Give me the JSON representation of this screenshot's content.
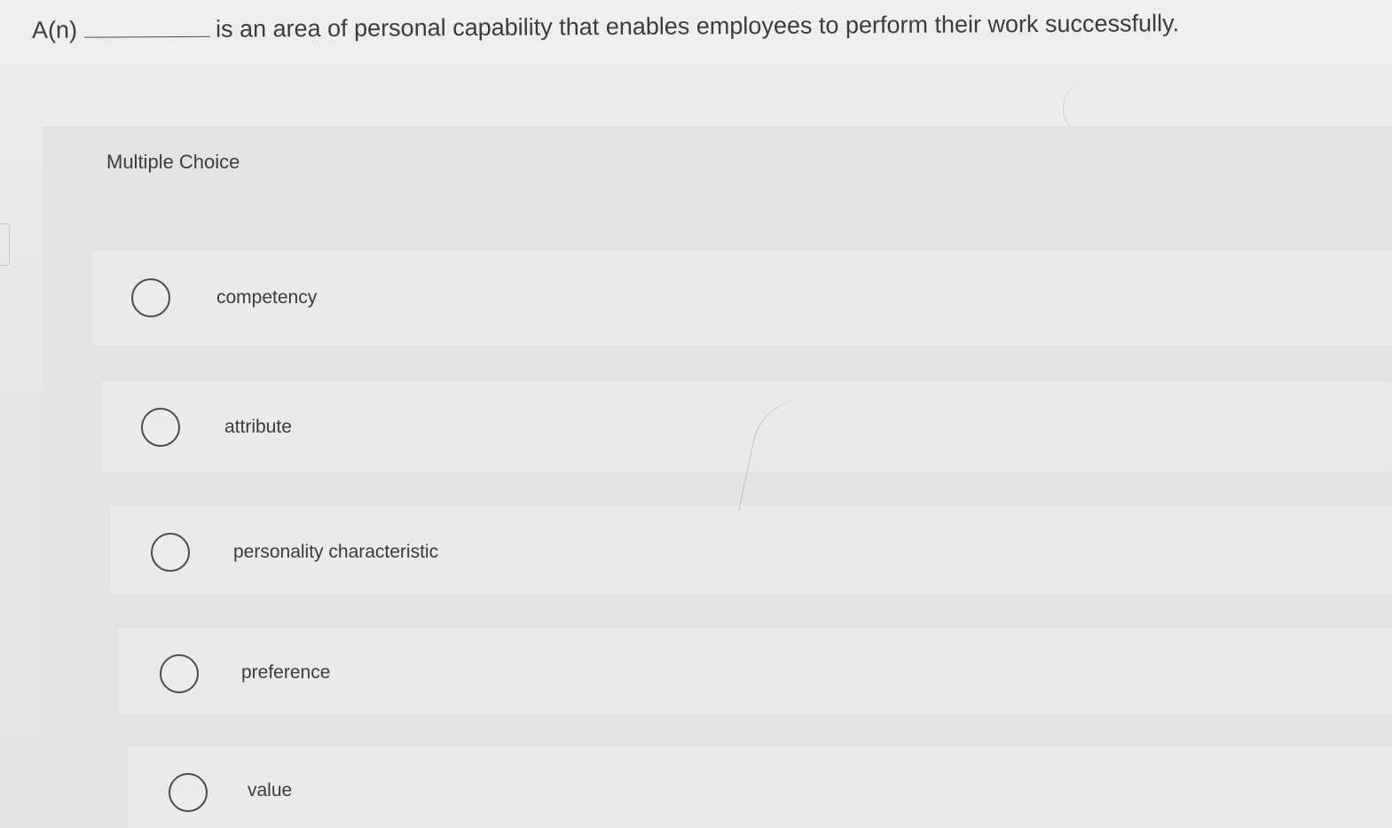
{
  "question": {
    "prefix": "A(n)",
    "suffix": "is an area of personal capability that enables employees to perform their work successfully."
  },
  "panel": {
    "title": "Multiple Choice"
  },
  "options": [
    {
      "label": "competency",
      "selected": false
    },
    {
      "label": "attribute",
      "selected": false
    },
    {
      "label": "personality characteristic",
      "selected": false
    },
    {
      "label": "preference",
      "selected": false
    },
    {
      "label": "value",
      "selected": false
    }
  ]
}
